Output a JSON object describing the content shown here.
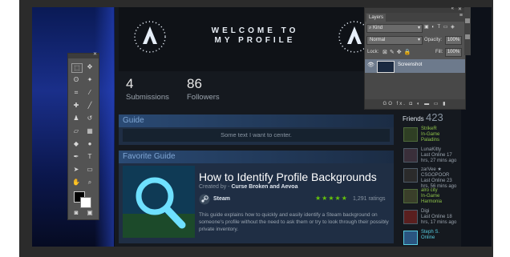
{
  "banner": {
    "title_line1": "WELCOME TO",
    "title_line2": "MY PROFILE"
  },
  "stats": [
    {
      "number": "4",
      "label": "Submissions"
    },
    {
      "number": "86",
      "label": "Followers"
    }
  ],
  "guide_panel": {
    "header": "Guide",
    "text": "Some text I want to center."
  },
  "favorite_guide": {
    "header": "Favorite Guide",
    "title": "How to Identify Profile Backgrounds",
    "created_by_prefix": "Created by -",
    "authors": "Curse Broken and Aevoa",
    "platform": "Steam",
    "stars": "★★★★★",
    "ratings": "1,291 ratings",
    "description": "This guide explains how to quickly and easily identify a Steam background on someone's profile without the need to ask them or try to look through their possibly private inventory."
  },
  "friends": {
    "label": "Friends",
    "count": "423",
    "items": [
      {
        "name": "StrikeR",
        "status": "In-Game",
        "detail": "Paladins",
        "color": "#8fc34a"
      },
      {
        "name": "LunaKitty",
        "status": "Last Online 17 hrs, 27 mins ago",
        "detail": "",
        "color": "#9aa3ad"
      },
      {
        "name": "zarVee ★ CSGOPOOR",
        "status": "Last Online 23 hrs, 56 mins ago",
        "detail": "",
        "color": "#9aa3ad"
      },
      {
        "name": "alro city",
        "status": "In-Game",
        "detail": "Harmonia",
        "color": "#8fc34a"
      },
      {
        "name": "Digi",
        "status": "Last Online 18 hrs, 17 mins ago",
        "detail": "",
        "color": "#9aa3ad"
      },
      {
        "name": "Steph S.",
        "status": "Online",
        "detail": "",
        "color": "#57cbde"
      }
    ]
  },
  "layers_panel": {
    "tab": "Layers",
    "kind_label": "Kind",
    "blend_mode": "Normal",
    "opacity_label": "Opacity:",
    "opacity_value": "100%",
    "lock_label": "Lock:",
    "fill_label": "Fill:",
    "fill_value": "100%",
    "layer_name": "Screenshot",
    "footer_icons": "GO fx. ◘ ◐ ▬ ▭ ▮"
  }
}
